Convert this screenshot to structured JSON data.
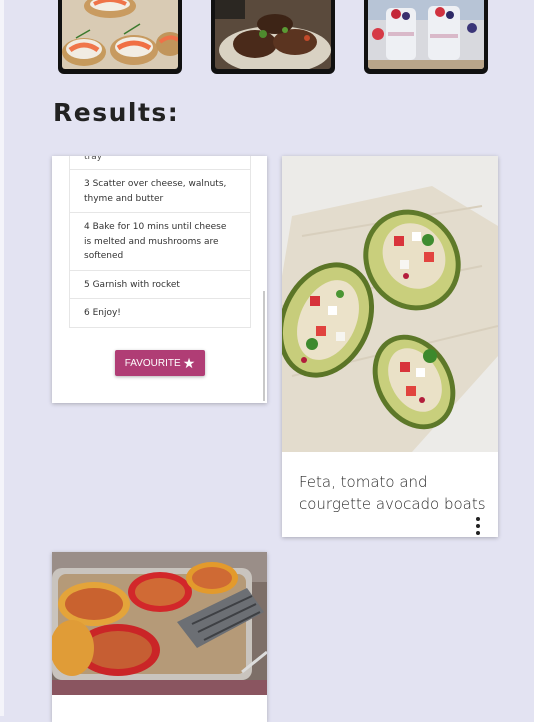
{
  "page": {
    "results_heading": "Results:",
    "background": "#e3e3f2",
    "accent": "#b03d75"
  },
  "thumbnails": [
    {
      "label": "salmon-canapes"
    },
    {
      "label": "grilled-meat"
    },
    {
      "label": "berry-parfait"
    }
  ],
  "steps_card": {
    "cut_step": "tray",
    "steps": [
      "3 Scatter over cheese, walnuts, thyme and butter",
      "4 Bake for 10 mins until cheese is melted and mushrooms are softened",
      "5 Garnish with rocket",
      "6 Enjoy!"
    ],
    "favourite_label": "FAVOURITE",
    "favourite_icon": "star-icon"
  },
  "recipe_cards": [
    {
      "title": "Feta, tomato and courgette avocado boats",
      "menu_icon": "more-vert-icon"
    }
  ]
}
